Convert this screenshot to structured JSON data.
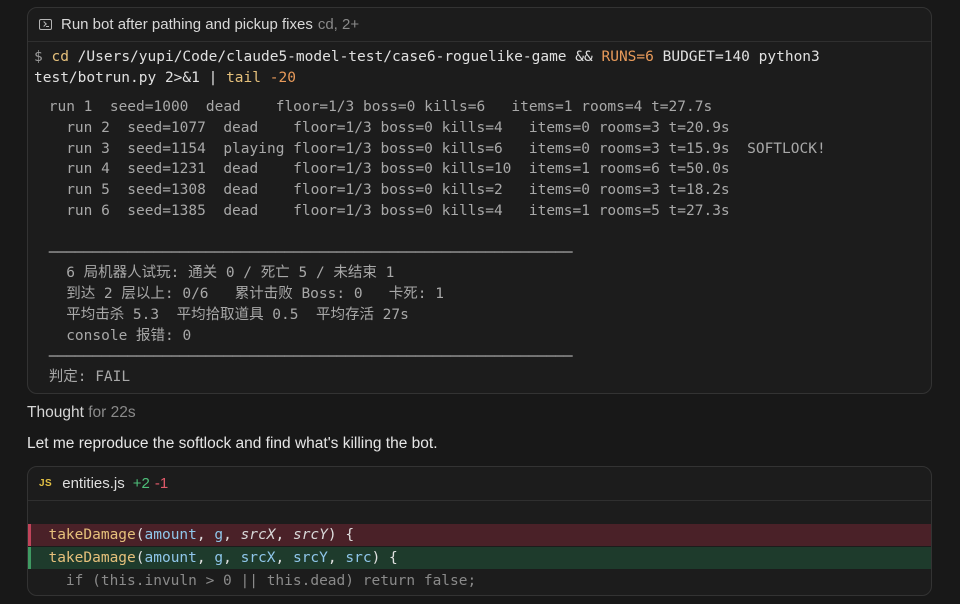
{
  "terminal": {
    "title": "Run bot after pathing and pickup fixes",
    "subtitle": "cd, 2+",
    "command": {
      "prompt": "$",
      "cd": "cd",
      "path": "/Users/yupi/Code/claude5-model-test/case6-roguelike-game",
      "and": "&&",
      "runs_env": "RUNS=6",
      "budget_env": "BUDGET=140",
      "python": "python3",
      "script": "test/botrun.py",
      "redirect": "2>&1 |",
      "tail": "tail",
      "tail_arg": "-20"
    },
    "output": " run 1  seed=1000  dead    floor=1/3 boss=0 kills=6   items=1 rooms=4 t=27.7s\n   run 2  seed=1077  dead    floor=1/3 boss=0 kills=4   items=0 rooms=3 t=20.9s\n   run 3  seed=1154  playing floor=1/3 boss=0 kills=6   items=0 rooms=3 t=15.9s  SOFTLOCK!\n   run 4  seed=1231  dead    floor=1/3 boss=0 kills=10  items=1 rooms=6 t=50.0s\n   run 5  seed=1308  dead    floor=1/3 boss=0 kills=2   items=0 rooms=3 t=18.2s\n   run 6  seed=1385  dead    floor=1/3 boss=0 kills=4   items=1 rooms=5 t=27.3s\n\n ────────────────────────────────────────────────────────────\n   6 局机器人试玩: 通关 0 / 死亡 5 / 未结束 1\n   到达 2 层以上: 0/6   累计击败 Boss: 0   卡死: 1\n   平均击杀 5.3  平均拾取道具 0.5  平均存活 27s\n   console 报错: 0\n ────────────────────────────────────────────────────────────\n 判定: FAIL"
  },
  "thought": {
    "label": "Thought",
    "duration": "for 22s"
  },
  "message": "Let me reproduce the softlock and find what's killing the bot.",
  "diff": {
    "lang_badge": "JS",
    "filename": "entities.js",
    "additions": "+2",
    "deletions": "-1",
    "del_line": {
      "fn": "takeDamage",
      "open": "(",
      "amount": "amount",
      "g": "g",
      "srcX": "srcX",
      "srcY": "srcY",
      "close": ") {"
    },
    "add_line": {
      "fn": "takeDamage",
      "open": "(",
      "amount": "amount",
      "g": "g",
      "srcX": "srcX",
      "srcY": "srcY",
      "src": "src",
      "close": ") {"
    },
    "ctx_line": "    if (this.invuln > 0 || this.dead) return false;"
  }
}
